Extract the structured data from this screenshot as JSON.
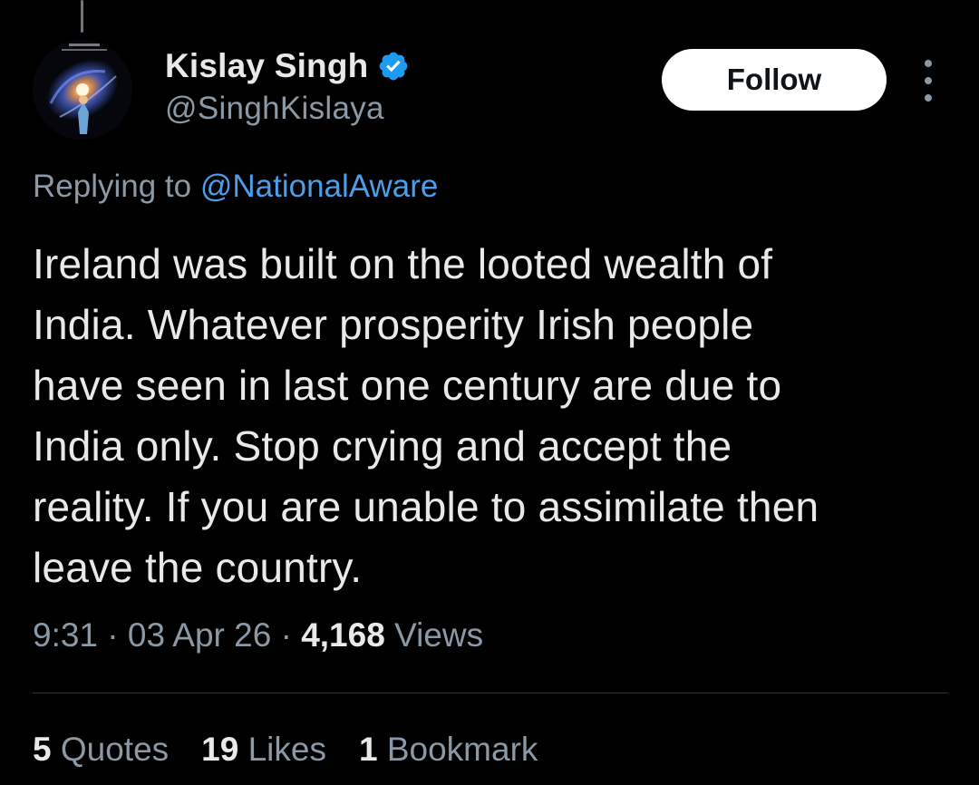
{
  "author": {
    "display_name": "Kislay Singh",
    "handle": "@SinghKislaya",
    "verified": true,
    "avatar_icon": "galaxy-avatar"
  },
  "actions": {
    "follow_label": "Follow",
    "more_icon": "more-vertical-icon"
  },
  "reply": {
    "prefix": "Replying to",
    "mention": "@NationalAware"
  },
  "tweet": {
    "text": "Ireland was built on the looted wealth of\nIndia. Whatever prosperity Irish people\nhave seen in last one century are due to\nIndia only. Stop crying and accept the\nreality. If you are unable to assimilate then\nleave the country."
  },
  "meta": {
    "time": "9:31",
    "separator": "·",
    "date": "03 Apr 26",
    "views_count": "4,168",
    "views_label": "Views"
  },
  "stats": [
    {
      "count": "5",
      "label": "Quotes"
    },
    {
      "count": "19",
      "label": "Likes"
    },
    {
      "count": "1",
      "label": "Bookmark"
    }
  ],
  "colors": {
    "background": "#000000",
    "text_primary": "#e7e9ea",
    "text_secondary": "#8b98a5",
    "link": "#4a9eea",
    "verified_badge": "#1d9bf0",
    "divider": "#2f3336"
  }
}
